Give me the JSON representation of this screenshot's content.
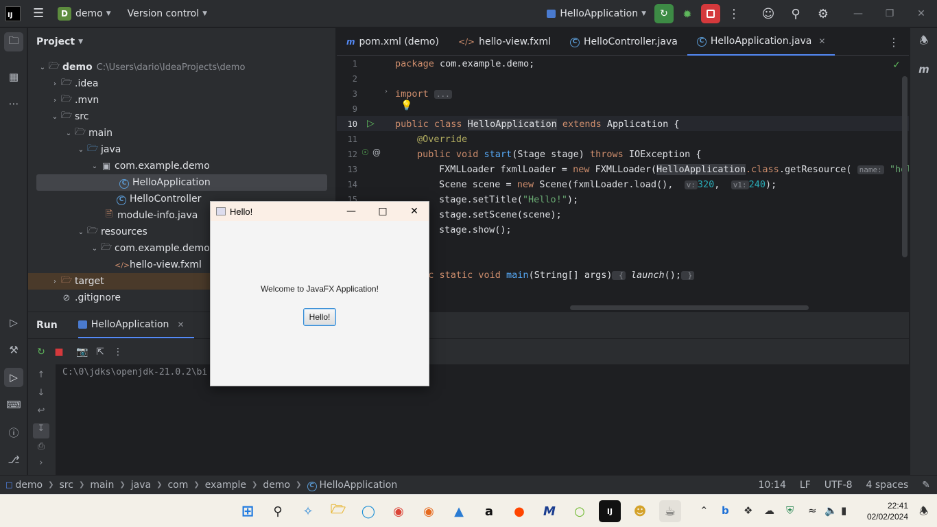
{
  "titlebar": {
    "project_badge": "D",
    "project_name": "demo",
    "vcs": "Version control",
    "run_config": "HelloApplication"
  },
  "project_panel": {
    "title": "Project",
    "tree": [
      {
        "label": "demo",
        "hint": "C:\\Users\\dario\\IdeaProjects\\demo",
        "depth": 0,
        "expanded": true,
        "icon": "module-folder-icon"
      },
      {
        "label": ".idea",
        "depth": 1,
        "expanded": false,
        "icon": "folder-icon"
      },
      {
        "label": ".mvn",
        "depth": 1,
        "expanded": false,
        "icon": "folder-icon"
      },
      {
        "label": "src",
        "depth": 1,
        "expanded": true,
        "icon": "folder-icon"
      },
      {
        "label": "main",
        "depth": 2,
        "expanded": true,
        "icon": "folder-icon"
      },
      {
        "label": "java",
        "depth": 3,
        "expanded": true,
        "icon": "source-folder-icon"
      },
      {
        "label": "com.example.demo",
        "depth": 4,
        "expanded": true,
        "icon": "package-icon"
      },
      {
        "label": "HelloApplication",
        "depth": 5,
        "icon": "java-class-icon",
        "selected": true
      },
      {
        "label": "HelloController",
        "depth": 5,
        "icon": "java-class-icon"
      },
      {
        "label": "module-info.java",
        "depth": 4,
        "icon": "java-file-icon"
      },
      {
        "label": "resources",
        "depth": 3,
        "expanded": true,
        "icon": "resources-folder-icon"
      },
      {
        "label": "com.example.demo",
        "depth": 4,
        "expanded": true,
        "icon": "package-icon"
      },
      {
        "label": "hello-view.fxml",
        "depth": 5,
        "icon": "fxml-file-icon"
      },
      {
        "label": "target",
        "depth": 1,
        "expanded": false,
        "icon": "folder-icon",
        "highlight": true
      },
      {
        "label": ".gitignore",
        "depth": 1,
        "icon": "ignore-file-icon"
      }
    ]
  },
  "editor": {
    "tabs": [
      {
        "label": "pom.xml (demo)",
        "icon": "maven-icon",
        "icon_glyph": "m"
      },
      {
        "label": "hello-view.fxml",
        "icon": "fxml-icon",
        "icon_glyph": "</>"
      },
      {
        "label": "HelloController.java",
        "icon": "java-class-icon",
        "icon_glyph": "C"
      },
      {
        "label": "HelloApplication.java",
        "icon": "java-class-icon",
        "icon_glyph": "C",
        "active": true
      }
    ],
    "line_numbers": [
      "1",
      "2",
      "3",
      "9",
      "10",
      "11",
      "12",
      "13",
      "14",
      "15"
    ],
    "code": {
      "l1_kw": "package",
      "l1_rest": " com.example.demo;",
      "l3_kw": "import",
      "l3_fold": "...",
      "l10_kw1": "public class ",
      "l10_name": "HelloApplication",
      "l10_kw2": " extends ",
      "l10_rest": "Application {",
      "l11_ann": "@Override",
      "l12_kw": "public void ",
      "l12_fn": "start",
      "l12_mid": "(Stage stage) ",
      "l12_kw2": "throws ",
      "l12_rest": "IOException {",
      "l13_a": "FXMLLoader fxmlLoader = ",
      "l13_kw": "new ",
      "l13_b": "FXMLLoader(",
      "l13_name": "HelloApplication",
      "l13_c": ".class",
      "l13_d": ".getResource(",
      "l13_hint": "name:",
      "l13_str": "\"hello",
      "l14_a": "Scene scene = ",
      "l14_kw": "new ",
      "l14_b": "Scene(fxmlLoader.load(), ",
      "l14_hint1": "v:",
      "l14_n1": "320",
      "l14_hint2": "v1:",
      "l14_n2": "240",
      "l14_end": ");",
      "l15_a": "stage.setTitle(",
      "l15_str": "\"Hello!\"",
      "l15_end": ");",
      "l16": "stage.setScene(scene);",
      "l17": "stage.show();",
      "l19_kw": "lic static void ",
      "l19_fn": "main",
      "l19_mid": "(String[] args)",
      "l19_b1": " {",
      "l19_call": " launch",
      "l19_end": "();",
      "l19_b2": " }"
    }
  },
  "run_panel": {
    "title": "Run",
    "tab_label": "HelloApplication",
    "console_line": "C:\\0\\jdks\\openjdk-21.0.2\\bi"
  },
  "statusbar": {
    "breadcrumbs": [
      "demo",
      "src",
      "main",
      "java",
      "com",
      "example",
      "demo",
      "HelloApplication"
    ],
    "position": "10:14",
    "line_sep": "LF",
    "encoding": "UTF-8",
    "indent": "4 spaces"
  },
  "fx_window": {
    "title": "Hello!",
    "label": "Welcome to JavaFX Application!",
    "button": "Hello!"
  },
  "taskbar": {
    "time": "22:41",
    "date": "02/02/2024"
  }
}
